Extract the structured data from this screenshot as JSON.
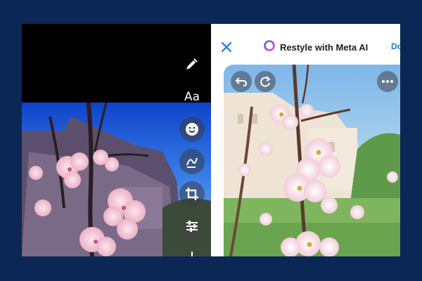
{
  "left_panel": {
    "tools": [
      {
        "name": "pen-icon"
      },
      {
        "name": "text-tool",
        "label": "Aa"
      },
      {
        "name": "sticker-icon"
      },
      {
        "name": "doodle-icon"
      },
      {
        "name": "crop-icon"
      },
      {
        "name": "adjust-icon"
      }
    ]
  },
  "right_panel": {
    "header": {
      "close_icon": "close-icon",
      "ai_icon": "meta-ai-ring-icon",
      "title": "Restyle with Meta AI",
      "done_label": "Do"
    },
    "overlay_buttons": [
      "undo-icon",
      "refresh-icon",
      "more-icon"
    ]
  },
  "colors": {
    "background": "#0b2755",
    "accent": "#1877f2",
    "sky_left": "#1e63e6",
    "sky_right": "#8fc5e9",
    "blossom": "#f3c9d6"
  }
}
